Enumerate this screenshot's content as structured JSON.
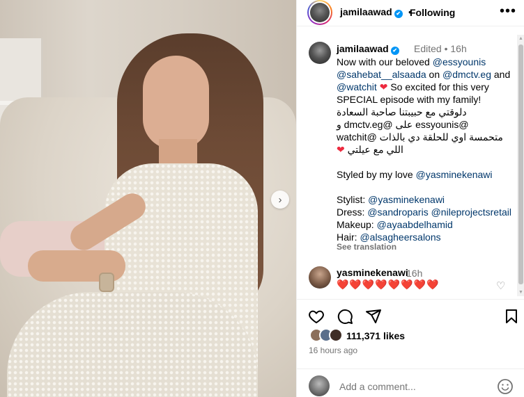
{
  "header": {
    "username": "jamilaawad",
    "separator": "•",
    "follow_label": "Following",
    "more_label": "•••"
  },
  "caption": {
    "username": "jamilaawad",
    "meta": "Edited • 16h",
    "lines": [
      "Now with our beloved",
      "@essyounis",
      "@sahebat__alsaada",
      "on",
      "@dmctv.eg",
      "and",
      "@watchit",
      "So excited for this very",
      "SPECIAL episode with my family!"
    ],
    "arabic": [
      "دلوقتي مع حبيبتنا صاحبة السعادة",
      "@essyounis على @dmctv.eg و",
      "متحمسة اوي للحلقة دي بالذات @watchit",
      "اللي مع عيلتي"
    ],
    "styled_by": "Styled by my love",
    "styled_by_mention": "@yasminekenawi",
    "credits": [
      {
        "label": "Stylist:",
        "mentions": "@yasminekenawi"
      },
      {
        "label": "Dress:",
        "mentions": "@sandroparis @nileprojectsretail"
      },
      {
        "label": "Makeup:",
        "mentions": "@ayaabdelhamid"
      },
      {
        "label": "Hair:",
        "mentions": "@alsagheersalons"
      }
    ],
    "see_translation": "See translation"
  },
  "comment": {
    "username": "yasminekenawi",
    "time": "16h",
    "text": "❤️❤️❤️❤️❤️❤️❤️❤️"
  },
  "engagement": {
    "likes": "111,371 likes",
    "time_ago": "16 hours ago"
  },
  "add_comment": {
    "placeholder": "Add a comment..."
  },
  "colors": {
    "verified": "#0095f6",
    "mention": "#00376b",
    "heart": "#ed2a3f",
    "muted": "#737373"
  },
  "icons": [
    "verified-badge-icon",
    "more-options-icon",
    "next-arrow-icon",
    "heart-icon",
    "comment-icon",
    "share-icon",
    "bookmark-icon",
    "emoji-icon"
  ]
}
